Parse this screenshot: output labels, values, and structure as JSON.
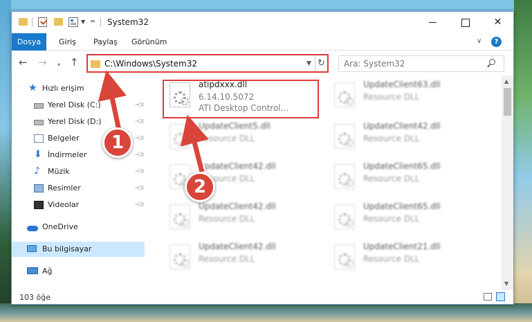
{
  "window": {
    "title": "System32",
    "controls": {
      "minimize": "–",
      "maximize": "□",
      "close": "✕"
    }
  },
  "ribbon": {
    "tabs": [
      {
        "label": "Dosya",
        "active": true
      },
      {
        "label": "Giriş"
      },
      {
        "label": "Paylaş"
      },
      {
        "label": "Görünüm"
      }
    ],
    "expand_icon": "chevron-down-icon",
    "help_label": "?"
  },
  "nav": {
    "back": "←",
    "forward": "→",
    "recent": "▾",
    "up": "↑",
    "address": "C:\\Windows\\System32",
    "refresh": "↻",
    "search_placeholder": "Ara: System32"
  },
  "sidebar": {
    "items": [
      {
        "label": "Hızlı erişim",
        "icon": "star-icon"
      },
      {
        "label": "Yerel Disk (C:)",
        "icon": "drive-icon",
        "pinned": true
      },
      {
        "label": "Yerel Disk (D:)",
        "icon": "drive-icon",
        "pinned": true
      },
      {
        "label": "Belgeler",
        "icon": "documents-icon",
        "pinned": true
      },
      {
        "label": "İndirmeler",
        "icon": "download-icon",
        "pinned": true
      },
      {
        "label": "Müzik",
        "icon": "music-icon",
        "pinned": true
      },
      {
        "label": "Resimler",
        "icon": "pictures-icon",
        "pinned": true
      },
      {
        "label": "Videolar",
        "icon": "video-icon",
        "pinned": true
      },
      {
        "label": "OneDrive",
        "icon": "cloud-icon"
      },
      {
        "label": "Bu bilgisayar",
        "icon": "pc-icon",
        "selected": true
      },
      {
        "label": "Ağ",
        "icon": "network-icon"
      }
    ]
  },
  "files": [
    {
      "name": "atipdxxx.dll",
      "line2": "6.14.10.5072",
      "line3": "ATI Desktop Control...",
      "highlighted": true
    },
    {
      "name": "UpdateClient63.dll",
      "line2": "Resource DLL"
    },
    {
      "name": "UpdateClient5.dll",
      "line2": "Resource DLL"
    },
    {
      "name": "UpdateClient42.dll",
      "line2": "Resource DLL"
    },
    {
      "name": "UpdateClient42.dll",
      "line2": "Resource DLL"
    },
    {
      "name": "UpdateClient65.dll",
      "line2": "Resource DLL"
    },
    {
      "name": "UpdateClient42.dll",
      "line2": "Resource DLL"
    },
    {
      "name": "UpdateClient65.dll",
      "line2": "Resource DLL"
    },
    {
      "name": "UpdateClient42.dll",
      "line2": "Resource DLL"
    },
    {
      "name": "UpdateClient21.dll",
      "line2": "Resource DLL"
    }
  ],
  "status": {
    "item_count": "103 öğe"
  },
  "annotations": {
    "badge1": "1",
    "badge2": "2",
    "color": "#d9453a"
  }
}
